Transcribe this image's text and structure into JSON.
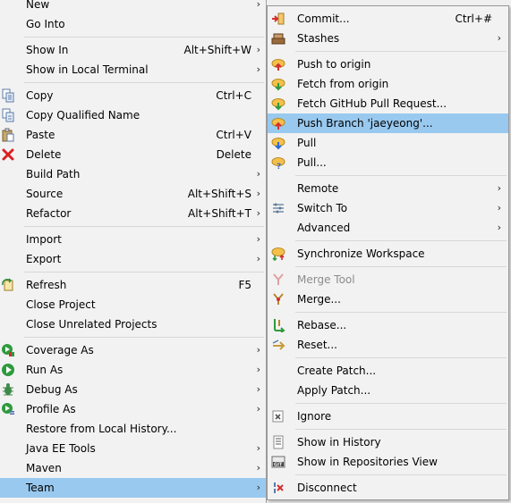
{
  "main_menu": {
    "items": [
      {
        "label": "New",
        "arrow": "›"
      },
      {
        "label": "Go Into"
      },
      {
        "label": "Show In",
        "shortcut": "Alt+Shift+W",
        "arrow": "›"
      },
      {
        "label": "Show in Local Terminal",
        "arrow": "›"
      },
      {
        "label": "Copy",
        "shortcut": "Ctrl+C",
        "icon": "copy-icon"
      },
      {
        "label": "Copy Qualified Name",
        "icon": "copy-qualified-name-icon"
      },
      {
        "label": "Paste",
        "shortcut": "Ctrl+V",
        "icon": "paste-icon"
      },
      {
        "label": "Delete",
        "shortcut": "Delete",
        "icon": "delete-icon"
      },
      {
        "label": "Build Path",
        "arrow": "›"
      },
      {
        "label": "Source",
        "shortcut": "Alt+Shift+S",
        "arrow": "›"
      },
      {
        "label": "Refactor",
        "shortcut": "Alt+Shift+T",
        "arrow": "›"
      },
      {
        "label": "Import",
        "arrow": "›"
      },
      {
        "label": "Export",
        "arrow": "›"
      },
      {
        "label": "Refresh",
        "shortcut": "F5",
        "icon": "refresh-icon"
      },
      {
        "label": "Close Project"
      },
      {
        "label": "Close Unrelated Projects"
      },
      {
        "label": "Coverage As",
        "arrow": "›",
        "icon": "coverage-icon"
      },
      {
        "label": "Run As",
        "arrow": "›",
        "icon": "run-icon"
      },
      {
        "label": "Debug As",
        "arrow": "›",
        "icon": "debug-icon"
      },
      {
        "label": "Profile As",
        "arrow": "›",
        "icon": "profile-icon"
      },
      {
        "label": "Restore from Local History..."
      },
      {
        "label": "Java EE Tools",
        "arrow": "›"
      },
      {
        "label": "Maven",
        "arrow": "›"
      },
      {
        "label": "Team",
        "arrow": "›"
      }
    ]
  },
  "team_menu": {
    "items": [
      {
        "label": "Commit...",
        "shortcut": "Ctrl+#",
        "icon": "commit-icon"
      },
      {
        "label": "Stashes",
        "arrow": "›",
        "icon": "stashes-icon"
      },
      {
        "label": "Push to origin",
        "icon": "push-icon"
      },
      {
        "label": "Fetch from origin",
        "icon": "fetch-icon"
      },
      {
        "label": "Fetch GitHub Pull Request...",
        "icon": "fetch-pull-request-icon"
      },
      {
        "label": "Push Branch 'jaeyeong'...",
        "icon": "push-branch-icon"
      },
      {
        "label": "Pull",
        "icon": "pull-icon"
      },
      {
        "label": "Pull...",
        "icon": "pull-dialog-icon"
      },
      {
        "label": "Remote",
        "arrow": "›"
      },
      {
        "label": "Switch To",
        "arrow": "›",
        "icon": "switch-branch-icon"
      },
      {
        "label": "Advanced",
        "arrow": "›"
      },
      {
        "label": "Synchronize Workspace",
        "icon": "synchronize-icon"
      },
      {
        "label": "Merge Tool",
        "icon": "merge-tool-icon"
      },
      {
        "label": "Merge...",
        "icon": "merge-icon"
      },
      {
        "label": "Rebase...",
        "icon": "rebase-icon"
      },
      {
        "label": "Reset...",
        "icon": "reset-icon"
      },
      {
        "label": "Create Patch..."
      },
      {
        "label": "Apply Patch..."
      },
      {
        "label": "Ignore",
        "icon": "ignore-icon"
      },
      {
        "label": "Show in History",
        "icon": "history-icon"
      },
      {
        "label": "Show in Repositories View",
        "icon": "git-repositories-icon"
      },
      {
        "label": "Disconnect",
        "icon": "disconnect-icon"
      }
    ]
  },
  "colors": {
    "menu_background": "#f2f2f2",
    "selection": "#99c9ef",
    "disabled_text": "#8c8c8c",
    "separator": "#d7d7d7"
  }
}
